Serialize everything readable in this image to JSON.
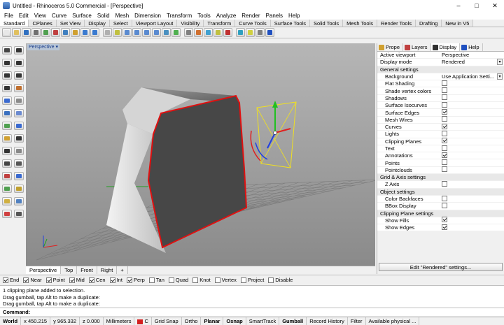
{
  "window": {
    "title": "Untitled - Rhinoceros 5.0 Commercial - [Perspective]",
    "controls": [
      "–",
      "□",
      "✕"
    ]
  },
  "menu": [
    "File",
    "Edit",
    "View",
    "Curve",
    "Surface",
    "Solid",
    "Mesh",
    "Dimension",
    "Transform",
    "Tools",
    "Analyze",
    "Render",
    "Panels",
    "Help"
  ],
  "toolbar_tabs": [
    "Standard",
    "CPlanes",
    "Set View",
    "Display",
    "Select",
    "Viewport Layout",
    "Visibility",
    "Transform",
    "Curve Tools",
    "Surface Tools",
    "Solid Tools",
    "Mesh Tools",
    "Render Tools",
    "Drafting",
    "New in V5"
  ],
  "viewport": {
    "label": "Perspective",
    "tabs": [
      "Perspective",
      "Top",
      "Front",
      "Right",
      "+"
    ]
  },
  "panel": {
    "tabs": [
      "Prope",
      "Layers",
      "Display",
      "Help"
    ],
    "rows": [
      {
        "k": "Active viewport",
        "v": "Perspective",
        "type": "text"
      },
      {
        "k": "Display mode",
        "v": "Rendered",
        "type": "dropdown"
      },
      {
        "k": "General settings",
        "type": "section"
      },
      {
        "k": "Background",
        "v": "Use Application Setti...",
        "type": "dropdown",
        "indent": true
      },
      {
        "k": "Flat Shading",
        "type": "check",
        "checked": false,
        "indent": true
      },
      {
        "k": "Shade vertex colors",
        "type": "check",
        "checked": false,
        "indent": true
      },
      {
        "k": "Shadows",
        "type": "check",
        "checked": false,
        "indent": true
      },
      {
        "k": "Surface Isocurves",
        "type": "check",
        "checked": false,
        "indent": true
      },
      {
        "k": "Surface Edges",
        "type": "check",
        "checked": true,
        "indent": true
      },
      {
        "k": "Mesh Wires",
        "type": "check",
        "checked": false,
        "indent": true
      },
      {
        "k": "Curves",
        "type": "check",
        "checked": true,
        "indent": true
      },
      {
        "k": "Lights",
        "type": "check",
        "checked": false,
        "indent": true
      },
      {
        "k": "Clipping Planes",
        "type": "check",
        "checked": true,
        "indent": true
      },
      {
        "k": "Text",
        "type": "check",
        "checked": false,
        "indent": true
      },
      {
        "k": "Annotations",
        "type": "check",
        "checked": true,
        "indent": true
      },
      {
        "k": "Points",
        "type": "check",
        "checked": false,
        "indent": true
      },
      {
        "k": "Pointclouds",
        "type": "check",
        "checked": false,
        "indent": true
      },
      {
        "k": "Grid & Axis settings",
        "type": "section"
      },
      {
        "k": "Z Axis",
        "type": "check",
        "checked": false,
        "indent": true
      },
      {
        "k": "Object settings",
        "type": "section"
      },
      {
        "k": "Color Backfaces",
        "type": "check",
        "checked": false,
        "indent": true
      },
      {
        "k": "BBox Display",
        "type": "check",
        "checked": false,
        "indent": true
      },
      {
        "k": "Clipping Plane settings",
        "type": "section"
      },
      {
        "k": "Show Fills",
        "type": "check",
        "checked": true,
        "indent": true
      },
      {
        "k": "Show Edges",
        "type": "check",
        "checked": true,
        "indent": true
      }
    ],
    "edit_button": "Edit \"Rendered\" settings..."
  },
  "osnap": [
    {
      "label": "End",
      "checked": true
    },
    {
      "label": "Near",
      "checked": true
    },
    {
      "label": "Point",
      "checked": true
    },
    {
      "label": "Mid",
      "checked": true
    },
    {
      "label": "Cen",
      "checked": true
    },
    {
      "label": "Int",
      "checked": true
    },
    {
      "label": "Perp",
      "checked": true
    },
    {
      "label": "Tan",
      "checked": false
    },
    {
      "label": "Quad",
      "checked": false
    },
    {
      "label": "Knot",
      "checked": false
    },
    {
      "label": "Vertex",
      "checked": false
    },
    {
      "label": "Project",
      "checked": false
    },
    {
      "label": "Disable",
      "checked": false
    }
  ],
  "command_history": [
    "1 clipping plane added to selection.",
    "Drag gumball, tap Alt to make a duplicate:",
    "Drag gumball, tap Alt to make a duplicate:"
  ],
  "command_prompt": "Command:",
  "status": {
    "cplane": "World",
    "x": "x 450.215",
    "y": "y 965.332",
    "z": "z 0.000",
    "units": "Millimeters",
    "layer": "C",
    "layer_color": "#d42020",
    "toggles": [
      "Grid Snap",
      "Ortho",
      "Planar",
      "Osnap",
      "SmartTrack",
      "Gumball",
      "Record History",
      "Filter"
    ],
    "bold_toggles": [
      "Planar",
      "Osnap",
      "Gumball"
    ],
    "memory": "Available physical ..."
  },
  "colors": {
    "viewport_bg": "#8e8e8e",
    "edge": "#e01010",
    "gizmo": "#f0e020"
  }
}
